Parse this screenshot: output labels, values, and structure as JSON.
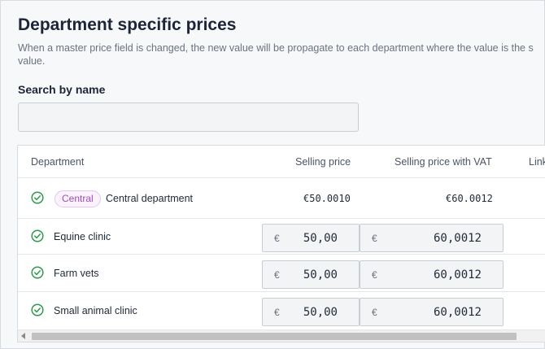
{
  "page": {
    "title": "Department specific prices",
    "description_line1": "When a master price field is changed, the new value will be propagate to each department where the value is the s",
    "description_line2": "value."
  },
  "search": {
    "label": "Search by name",
    "value": "",
    "placeholder": ""
  },
  "table": {
    "columns": [
      "Department",
      "Selling price",
      "Selling price with VAT",
      "Link"
    ],
    "rows": [
      {
        "status_icon": "check-circle-icon",
        "badge": "Central",
        "name": "Central department",
        "selling_price": "€50.0010",
        "selling_price_vat": "€60.0012"
      },
      {
        "status_icon": "check-circle-icon",
        "name": "Equine clinic",
        "currency": "€",
        "selling_price": "50,00",
        "selling_price_vat": "60,0012"
      },
      {
        "status_icon": "check-circle-icon",
        "name": "Farm vets",
        "currency": "€",
        "selling_price": "50,00",
        "selling_price_vat": "60,0012"
      },
      {
        "status_icon": "check-circle-icon",
        "name": "Small animal clinic",
        "currency": "€",
        "selling_price": "50,00",
        "selling_price_vat": "60,0012"
      }
    ]
  },
  "colors": {
    "check_green": "#2e9a4c",
    "badge_purple": "#9d4eb7",
    "title": "#1b2537"
  }
}
